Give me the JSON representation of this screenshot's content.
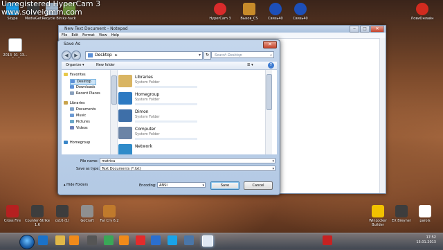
{
  "watermark": {
    "line1": "Unregistered HyperCam 3",
    "line2": "www.solveigmm.com"
  },
  "desktop_icons_top": [
    {
      "label": "Skype",
      "color": "#1a9be6"
    },
    {
      "label": "MediaGet",
      "color": "#3a3a3a"
    },
    {
      "label": "Recycle Bin",
      "color": "#9fb3c6"
    },
    {
      "label": "kz-hack",
      "color": "#6b8f3a"
    },
    {
      "label": "HyperCam 3",
      "color": "#d92b2b"
    },
    {
      "label": "Вызов_CS",
      "color": "#c78b2a"
    },
    {
      "label": "Связь40",
      "color": "#1d4fb8"
    },
    {
      "label": "Связь40",
      "color": "#1d4fb8"
    },
    {
      "label": "ЛовиОнлайн",
      "color": "#d12b1f"
    }
  ],
  "desktop_icon_left": {
    "label": "2013_01_13...",
    "color": "#ffffff"
  },
  "desktop_icons_bottom": [
    {
      "label": "Cross Fire",
      "color": "#b52020"
    },
    {
      "label": "Counter-Strike 1.6",
      "color": "#3d3d3d"
    },
    {
      "label": "cs16 (1)",
      "color": "#3d3d3d"
    },
    {
      "label": "GoCraft",
      "color": "#8f8f8f"
    },
    {
      "label": "Far Cry 6.2",
      "color": "#c07a2c"
    },
    {
      "label": "WinLocker Builder",
      "color": "#f2c200"
    },
    {
      "label": "EX Breyner",
      "color": "#3d3d3d"
    },
    {
      "label": "parols",
      "color": "#ffffff"
    }
  ],
  "notepad": {
    "title": "New Text Document - Notepad",
    "menu": [
      "File",
      "Edit",
      "Format",
      "View",
      "Help"
    ]
  },
  "dialog": {
    "title": "Save As",
    "close": "✕",
    "address": "Desktop",
    "address_arrow": "▸",
    "search_placeholder": "Search Desktop",
    "toolbar": {
      "organize": "Organize ▾",
      "new_folder": "New folder",
      "views": "☰ ▾",
      "help": "?"
    },
    "left_pane": [
      {
        "label": "Favorites",
        "color": "#e8c94a",
        "indent": 0
      },
      {
        "label": "Desktop",
        "color": "#5b8fd6",
        "indent": 1,
        "selected": true
      },
      {
        "label": "Downloads",
        "color": "#5b8fd6",
        "indent": 1
      },
      {
        "label": "Recent Places",
        "color": "#8aa1bd",
        "indent": 1
      },
      {
        "label": "Libraries",
        "color": "#c9a34b",
        "indent": 0
      },
      {
        "label": "Documents",
        "color": "#7fa2c9",
        "indent": 1
      },
      {
        "label": "Music",
        "color": "#6c9ad3",
        "indent": 1
      },
      {
        "label": "Pictures",
        "color": "#6aa7c9",
        "indent": 1
      },
      {
        "label": "Videos",
        "color": "#6c7fb8",
        "indent": 1
      },
      {
        "label": "Homegroup",
        "color": "#3a86c8",
        "indent": 0
      }
    ],
    "items": [
      {
        "name": "Libraries",
        "sub": "System Folder",
        "color": "#d9b563"
      },
      {
        "name": "Homegroup",
        "sub": "System Folder",
        "color": "#2d7ac2"
      },
      {
        "name": "Dimon",
        "sub": "System Folder",
        "color": "#3e6fa8"
      },
      {
        "name": "Computer",
        "sub": "System Folder",
        "color": "#6b84a6"
      },
      {
        "name": "Network",
        "sub": "",
        "color": "#2f8bc9"
      }
    ],
    "file_name_label": "File name:",
    "file_name_value": "matrica",
    "save_as_type_label": "Save as type:",
    "save_as_type_value": "Text Documents (*.txt)",
    "hide_folders": "Hide Folders",
    "encoding_label": "Encoding:",
    "encoding_value": "ANSI",
    "save_button": "Save",
    "cancel_button": "Cancel"
  },
  "taskbar": {
    "clock_time": "17:52",
    "clock_date": "13.01.2013",
    "apps": [
      {
        "name": "ie-icon",
        "color": "#1a72c9"
      },
      {
        "name": "explorer-icon",
        "color": "#e0b748"
      },
      {
        "name": "media-player-icon",
        "color": "#f08a1a"
      },
      {
        "name": "camera-icon",
        "color": "#555555"
      },
      {
        "name": "chrome-icon",
        "color": "#3aa757"
      },
      {
        "name": "odnoklassniki-icon",
        "color": "#f08a1a"
      },
      {
        "name": "yandex-icon",
        "color": "#e32b2b"
      },
      {
        "name": "mail-icon",
        "color": "#2b6fcf"
      },
      {
        "name": "skype-icon",
        "color": "#19a3e8"
      },
      {
        "name": "vkontakte-icon",
        "color": "#4a76a8"
      },
      {
        "name": "notepad-icon",
        "color": "#dfe8f3"
      },
      {
        "name": "hypercam-icon",
        "color": "#c62222"
      }
    ]
  }
}
